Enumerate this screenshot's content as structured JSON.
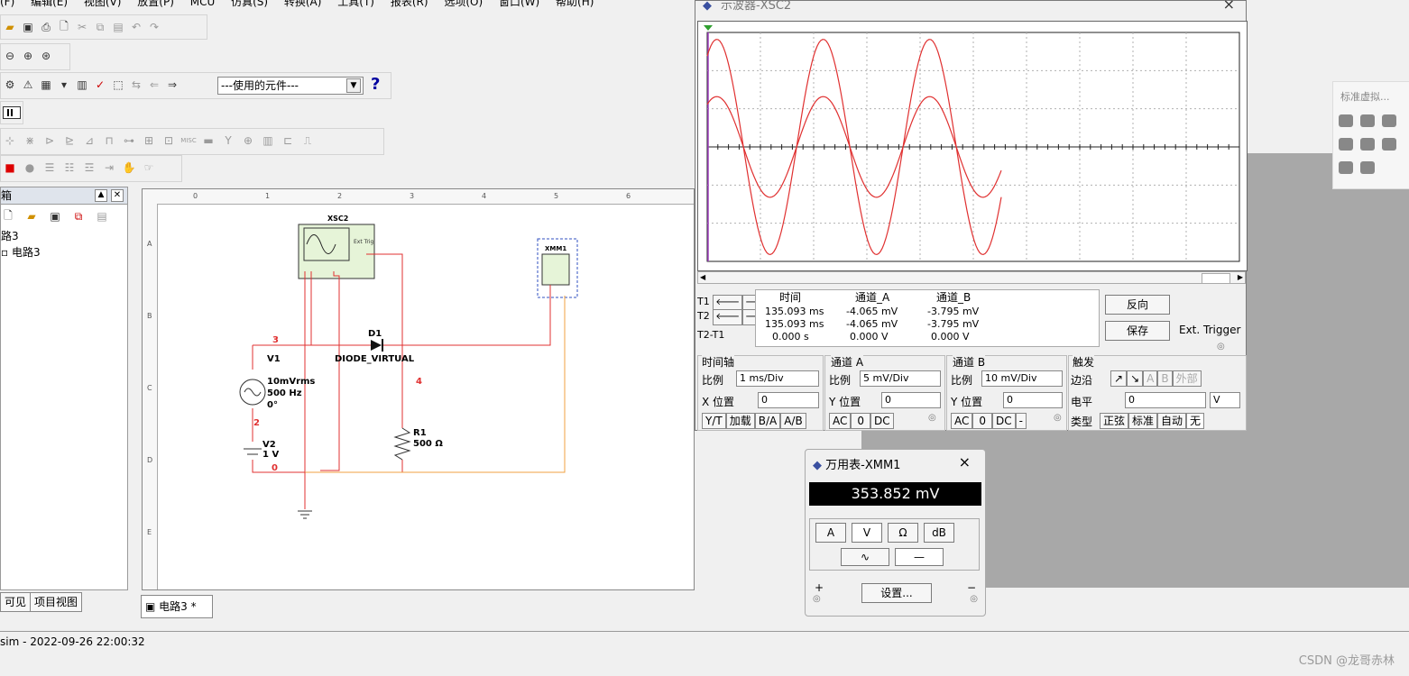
{
  "menu": [
    "(F)",
    "编辑(E)",
    "视图(V)",
    "放置(P)",
    "MCU",
    "仿真(S)",
    "转换(A)",
    "工具(T)",
    "报表(R)",
    "选项(O)",
    "窗口(W)",
    "帮助(H)"
  ],
  "toolbar": {
    "component_select": "---使用的元件---",
    "help_icon": "?"
  },
  "left_panel": {
    "title": "箱",
    "tree": [
      "路3",
      "电路3"
    ],
    "tabs": [
      "可见",
      "项目视图"
    ]
  },
  "canvas": {
    "tab_label": "电路3 *",
    "ruler_cols": [
      "0",
      "1",
      "2",
      "3",
      "4",
      "5",
      "6"
    ],
    "ruler_rows": [
      "A",
      "B",
      "C",
      "D",
      "E"
    ],
    "components": {
      "xsc2_label": "XSC2",
      "xmm1_label": "XMM1",
      "d1_label": "D1",
      "diode_type": "DIODE_VIRTUAL",
      "v1_label": "V1",
      "v1_value1": "10mVrms",
      "v1_value2": "500 Hz",
      "v1_value3": "0°",
      "v2_label": "V2",
      "v2_value": "1 V",
      "r1_label": "R1",
      "r1_value": "500 Ω",
      "net3": "3",
      "net2": "2",
      "net0": "0",
      "net4": "4",
      "ext_trig": "Ext Trig"
    }
  },
  "status": {
    "text": "sim  -  2022-09-26 22:00:32"
  },
  "oscilloscope": {
    "title": "示波器-XSC2",
    "close": "×",
    "readout_headers": [
      "时间",
      "通道_A",
      "通道_B"
    ],
    "t1": {
      "label": "T1",
      "time": "135.093 ms",
      "a": "-4.065 mV",
      "b": "-3.795 mV"
    },
    "t2": {
      "label": "T2",
      "time": "135.093 ms",
      "a": "-4.065 mV",
      "b": "-3.795 mV"
    },
    "t2t1": {
      "label": "T2-T1",
      "time": "0.000 s",
      "a": "0.000 V",
      "b": "0.000 V"
    },
    "reverse_btn": "反向",
    "save_btn": "保存",
    "ext_trigger": "Ext. Trigger",
    "timebase": {
      "title": "时间轴",
      "scale_label": "比例",
      "scale": "1 ms/Div",
      "xpos_label": "X 位置",
      "xpos": "0",
      "modes": [
        "Y/T",
        "加载",
        "B/A",
        "A/B"
      ]
    },
    "channel_a": {
      "title": "通道 A",
      "scale_label": "比例",
      "scale": "5 mV/Div",
      "ypos_label": "Y 位置",
      "ypos": "0",
      "coupling": [
        "AC",
        "0",
        "DC"
      ]
    },
    "channel_b": {
      "title": "通道 B",
      "scale_label": "比例",
      "scale": "10 mV/Div",
      "ypos_label": "Y 位置",
      "ypos": "0",
      "coupling": [
        "AC",
        "0",
        "DC",
        "-"
      ]
    },
    "trigger": {
      "title": "触发",
      "edge_label": "边沿",
      "edge_btns": [
        "A",
        "B",
        "外部"
      ],
      "level_label": "电平",
      "level": "0",
      "level_unit": "V",
      "type_label": "类型",
      "types": [
        "正弦",
        "标准",
        "自动",
        "无"
      ]
    }
  },
  "multimeter": {
    "title": "万用表-XMM1",
    "close": "×",
    "reading": "353.852 mV",
    "modes": [
      "A",
      "V",
      "Ω",
      "dB"
    ],
    "settings_btn": "设置...",
    "plus": "+",
    "minus": "−"
  },
  "floating_toolbar": {
    "title": "标准虚拟..."
  },
  "watermark": "CSDN @龙哥赤林",
  "colors": {
    "trace": "#e03030",
    "wire_red": "#e03030",
    "wire_orange": "#f0a040",
    "grid": "#b0b0b0"
  }
}
